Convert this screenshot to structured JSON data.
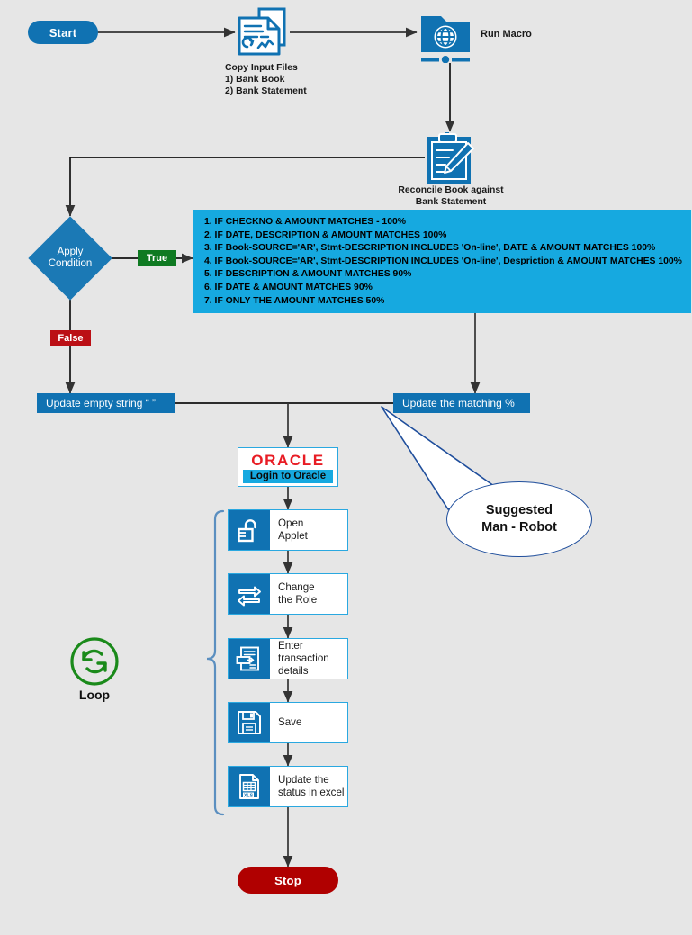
{
  "diagram": {
    "title": "Bank Reconciliation Automation Flow",
    "background": "#e6e6e6"
  },
  "colors": {
    "process_blue": "#1072b2",
    "panel_cyan": "#16a9e0",
    "diamond_blue": "#1b79b5",
    "true_green": "#0f7a22",
    "false_red": "#bb0f15",
    "stop_red": "#b00000",
    "oracle_red": "#e81c24",
    "callout_border": "#1f4e9c",
    "loop_green": "#1a8a1a",
    "card_border": "#2aa8e0",
    "connector": "#333333"
  },
  "nodes": {
    "start": {
      "label": "Start"
    },
    "copy_input": {
      "icon": "documents-icon",
      "caption_lines": [
        "Copy Input Files",
        "1) Bank Book",
        "2) Bank Statement"
      ]
    },
    "run_macro": {
      "icon": "folder-globe-icon",
      "label": "Run Macro"
    },
    "reconcile": {
      "icon": "clipboard-pencil-icon",
      "caption_lines": [
        "Reconcile Book against",
        "Bank Statement"
      ]
    },
    "apply_condition": {
      "label_lines": [
        "Apply",
        "Condition"
      ]
    },
    "true_tag": {
      "label": "True"
    },
    "false_tag": {
      "label": "False"
    },
    "rules": {
      "items": [
        "1. IF CHECKNO & AMOUNT MATCHES - 100%",
        "2. IF DATE, DESCRIPTION & AMOUNT MATCHES 100%",
        "3. IF Book-SOURCE='AR', Stmt-DESCRIPTION INCLUDES 'On-line', DATE & AMOUNT MATCHES 100%",
        "4. IF Book-SOURCE='AR', Stmt-DESCRIPTION INCLUDES 'On-line', Despriction & AMOUNT MATCHES 100%",
        "5. IF DESCRIPTION & AMOUNT MATCHES 90%",
        "6. IF DATE & AMOUNT MATCHES 90%",
        "7. IF ONLY THE AMOUNT MATCHES 50%"
      ]
    },
    "update_empty": {
      "label": "Update empty string “ ”"
    },
    "update_matching": {
      "label": "Update the matching %"
    },
    "oracle": {
      "logo": "ORACLE",
      "label": "Login to Oracle"
    },
    "steps": [
      {
        "icon": "unlock-icon",
        "label": "Open\nApplet",
        "lines": [
          "Open",
          "Applet"
        ]
      },
      {
        "icon": "swap-arrows-icon",
        "label": "Change\nthe Role",
        "lines": [
          "Change",
          "the Role"
        ]
      },
      {
        "icon": "data-entry-icon",
        "label": "Enter\ntransaction\ndetails",
        "lines": [
          "Enter",
          "transaction",
          "details"
        ]
      },
      {
        "icon": "floppy-save-icon",
        "label": "Save",
        "lines": [
          "Save"
        ]
      },
      {
        "icon": "excel-file-icon",
        "label": "Update the\nstatus in excel",
        "lines": [
          "Update the",
          "status in excel"
        ]
      }
    ],
    "loop": {
      "icon": "refresh-loop-icon",
      "label": "Loop"
    },
    "callout": {
      "lines": [
        "Suggested",
        "Man - Robot"
      ]
    },
    "stop": {
      "label": "Stop"
    }
  }
}
